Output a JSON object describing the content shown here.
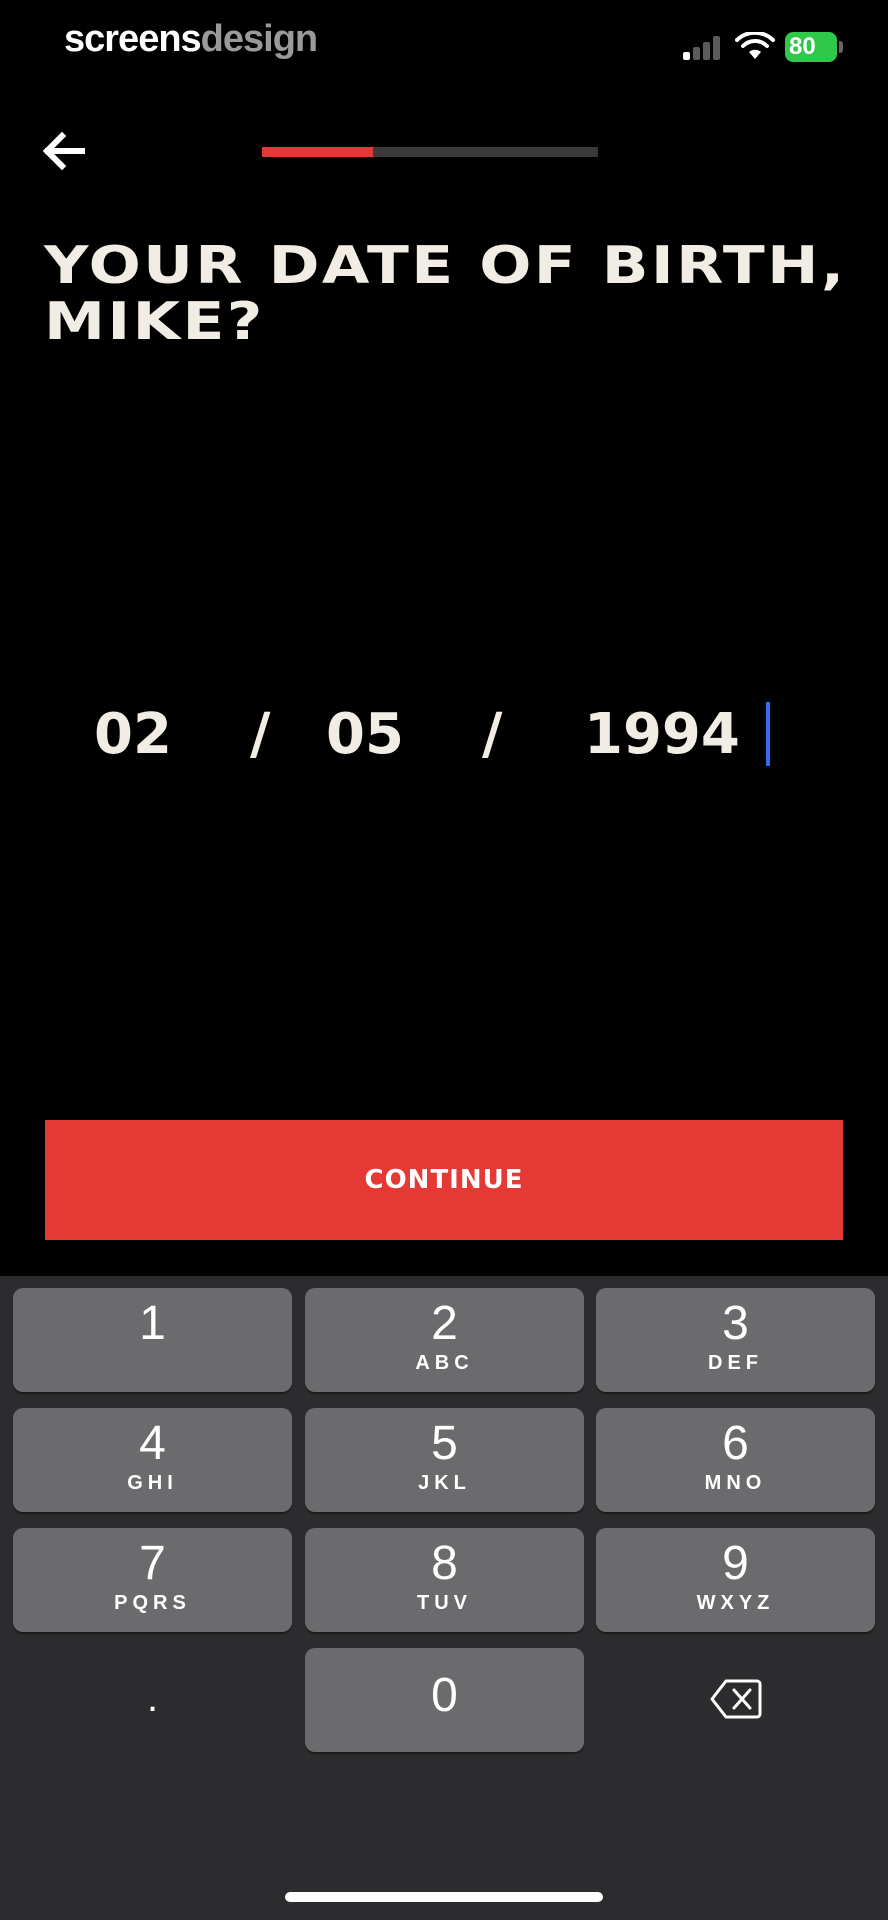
{
  "status_bar": {
    "brand_part1": "screens",
    "brand_part2": "design",
    "battery": "80"
  },
  "nav": {
    "back_icon": "arrow-left-icon",
    "progress_fraction": 0.33
  },
  "title": "YOUR DATE OF BIRTH, MIKE?",
  "date": {
    "month": "02",
    "day": "05",
    "year": "1994",
    "separator": "/"
  },
  "continue_label": "CONTINUE",
  "keyboard": {
    "keys": [
      {
        "num": "1",
        "letters": ""
      },
      {
        "num": "2",
        "letters": "ABC"
      },
      {
        "num": "3",
        "letters": "DEF"
      },
      {
        "num": "4",
        "letters": "GHI"
      },
      {
        "num": "5",
        "letters": "JKL"
      },
      {
        "num": "6",
        "letters": "MNO"
      },
      {
        "num": "7",
        "letters": "PQRS"
      },
      {
        "num": "8",
        "letters": "TUV"
      },
      {
        "num": "9",
        "letters": "WXYZ"
      },
      {
        "num": "0",
        "letters": ""
      }
    ],
    "dot_label": ".",
    "delete_icon": "backspace-icon"
  },
  "colors": {
    "accent": "#e53935",
    "caret": "#2f6cf0",
    "battery": "#2fc84a"
  }
}
